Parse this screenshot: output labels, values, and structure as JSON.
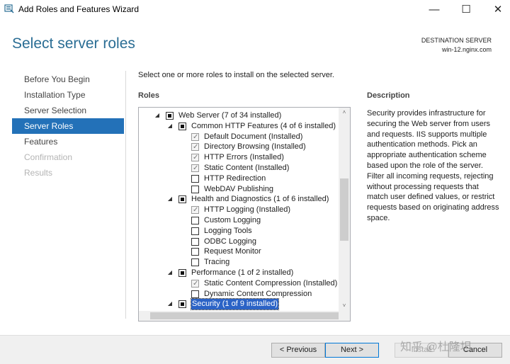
{
  "window": {
    "title": "Add Roles and Features Wizard",
    "controls": {
      "minimize": "—",
      "maximize": "☐",
      "close": "✕"
    }
  },
  "page_title": "Select server roles",
  "destination": {
    "label": "DESTINATION SERVER",
    "server": "win-12.nginx.com"
  },
  "nav": [
    {
      "label": "Before You Begin",
      "state": "normal"
    },
    {
      "label": "Installation Type",
      "state": "normal"
    },
    {
      "label": "Server Selection",
      "state": "normal"
    },
    {
      "label": "Server Roles",
      "state": "active"
    },
    {
      "label": "Features",
      "state": "normal"
    },
    {
      "label": "Confirmation",
      "state": "disabled"
    },
    {
      "label": "Results",
      "state": "disabled"
    }
  ],
  "instruction": "Select one or more roles to install on the selected server.",
  "roles_label": "Roles",
  "description": {
    "label": "Description",
    "text": "Security provides infrastructure for securing the Web server from users and requests. IIS supports multiple authentication methods. Pick an appropriate authentication scheme based upon the role of the server. Filter all incoming requests, rejecting without processing requests that match user defined values, or restrict requests based on originating address space."
  },
  "tree": [
    {
      "level": 0,
      "expander": "◢",
      "check": "partial",
      "label": "Web Server (7 of 34 installed)"
    },
    {
      "level": 1,
      "expander": "◢",
      "check": "partial",
      "label": "Common HTTP Features (4 of 6 installed)"
    },
    {
      "level": 2,
      "check": "checked",
      "label": "Default Document (Installed)"
    },
    {
      "level": 2,
      "check": "checked",
      "label": "Directory Browsing (Installed)"
    },
    {
      "level": 2,
      "check": "checked",
      "label": "HTTP Errors (Installed)"
    },
    {
      "level": 2,
      "check": "checked",
      "label": "Static Content (Installed)"
    },
    {
      "level": 2,
      "check": "none",
      "label": "HTTP Redirection"
    },
    {
      "level": 2,
      "check": "none",
      "label": "WebDAV Publishing"
    },
    {
      "level": 1,
      "expander": "◢",
      "check": "partial",
      "label": "Health and Diagnostics (1 of 6 installed)"
    },
    {
      "level": 2,
      "check": "checked",
      "label": "HTTP Logging (Installed)"
    },
    {
      "level": 2,
      "check": "none",
      "label": "Custom Logging"
    },
    {
      "level": 2,
      "check": "none",
      "label": "Logging Tools"
    },
    {
      "level": 2,
      "check": "none",
      "label": "ODBC Logging"
    },
    {
      "level": 2,
      "check": "none",
      "label": "Request Monitor"
    },
    {
      "level": 2,
      "check": "none",
      "label": "Tracing"
    },
    {
      "level": 1,
      "expander": "◢",
      "check": "partial",
      "label": "Performance (1 of 2 installed)"
    },
    {
      "level": 2,
      "check": "checked",
      "label": "Static Content Compression (Installed)"
    },
    {
      "level": 2,
      "check": "none",
      "label": "Dynamic Content Compression"
    },
    {
      "level": 1,
      "expander": "◢",
      "check": "partial",
      "label": "Security (1 of 9 installed)",
      "selected": true
    }
  ],
  "scroll": {
    "up": "˄",
    "down": "˅"
  },
  "footer": {
    "previous": "< Previous",
    "next": "Next >",
    "install": "Install",
    "cancel": "Cancel",
    "watermark": "知乎 @杜隆坦"
  }
}
